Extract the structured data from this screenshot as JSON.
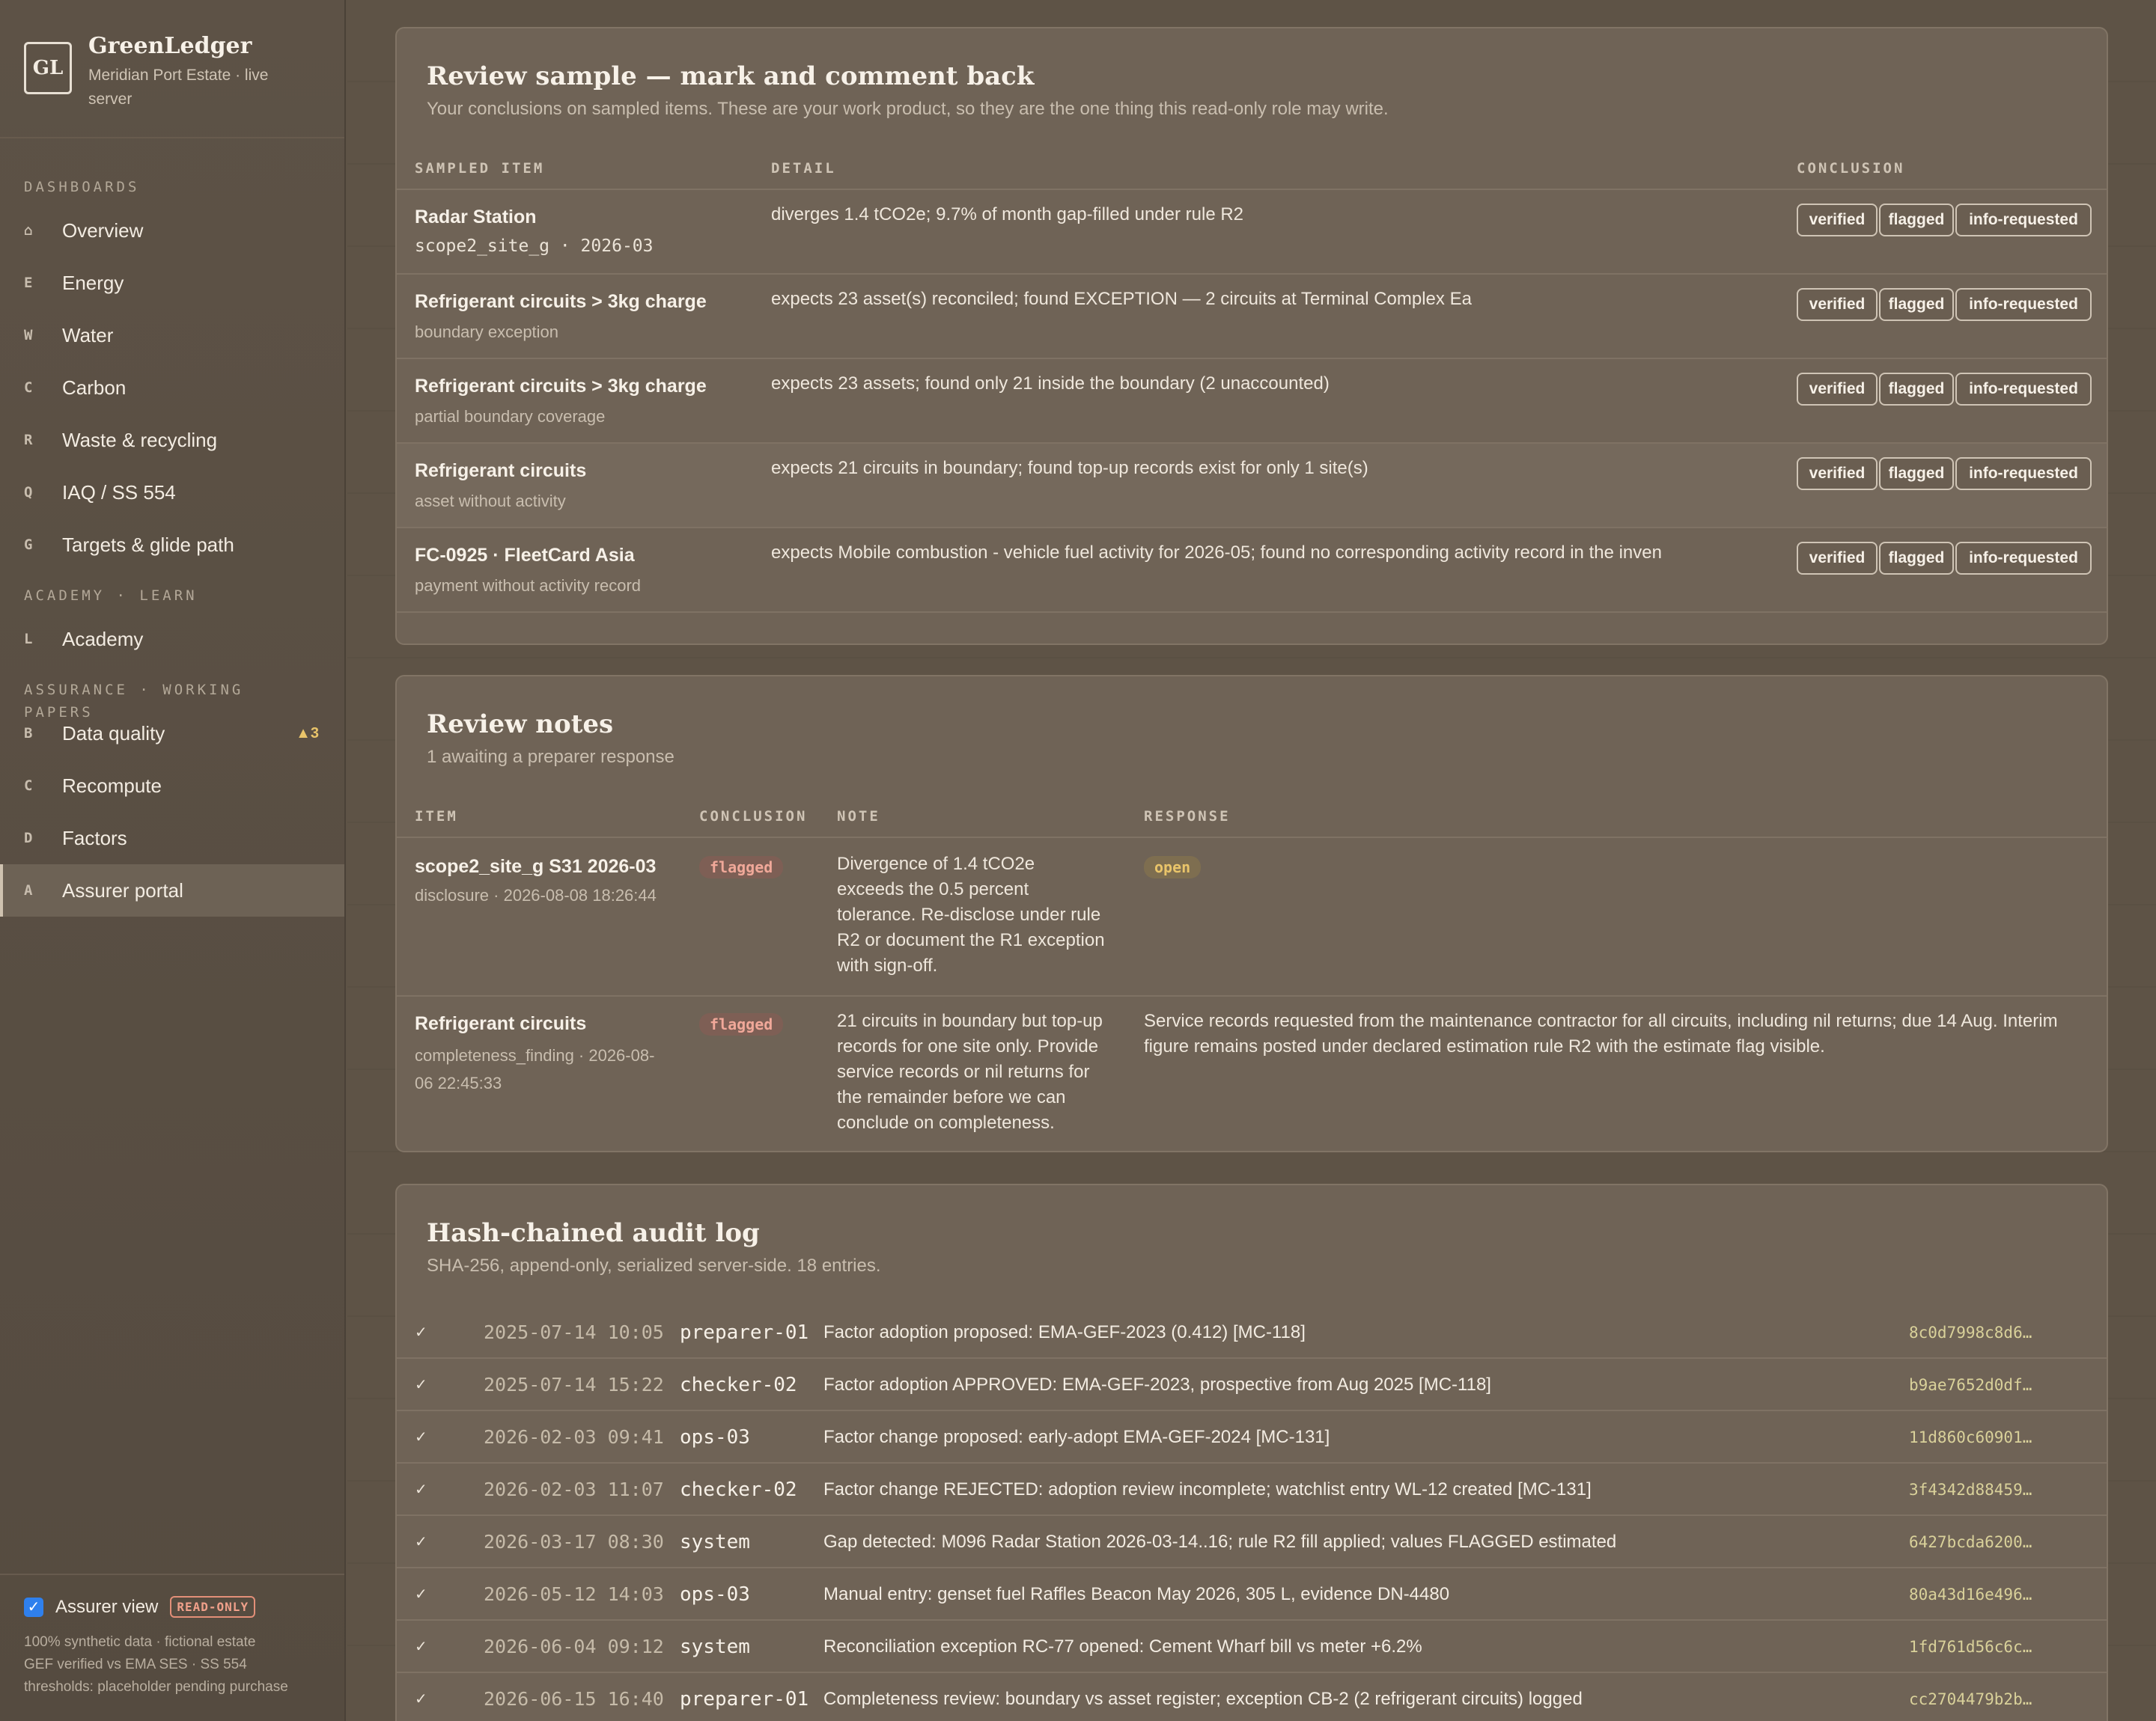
{
  "brand": {
    "logo": "GL",
    "name": "GreenLedger",
    "subtitle": "Meridian Port Estate · live server"
  },
  "sidebar": {
    "sections": [
      {
        "title": "DASHBOARDS",
        "items": [
          {
            "key": "⌂",
            "label": "Overview"
          },
          {
            "key": "E",
            "label": "Energy"
          },
          {
            "key": "W",
            "label": "Water"
          },
          {
            "key": "C",
            "label": "Carbon"
          },
          {
            "key": "R",
            "label": "Waste & recycling"
          },
          {
            "key": "Q",
            "label": "IAQ / SS 554"
          },
          {
            "key": "G",
            "label": "Targets & glide path"
          }
        ]
      },
      {
        "title": "ACADEMY · LEARN",
        "items": [
          {
            "key": "L",
            "label": "Academy"
          }
        ]
      },
      {
        "title": "ASSURANCE · WORKING PAPERS",
        "items": [
          {
            "key": "B",
            "label": "Data quality",
            "badge": "▲3"
          },
          {
            "key": "C",
            "label": "Recompute"
          },
          {
            "key": "D",
            "label": "Factors"
          },
          {
            "key": "A",
            "label": "Assurer portal",
            "active": true
          }
        ]
      }
    ],
    "footer": {
      "assurer_view_label": "Assurer view",
      "assurer_view_checked": true,
      "read_only_badge": "READ-ONLY",
      "lines": [
        "100% synthetic data · fictional estate",
        "GEF verified vs EMA SES · SS 554",
        "thresholds: placeholder pending purchase"
      ]
    }
  },
  "review_sample": {
    "title": "Review sample — mark and comment back",
    "subtitle": "Your conclusions on sampled items. These are your work product, so they are the one thing this read-only role may write.",
    "headers": {
      "item": "SAMPLED ITEM",
      "detail": "DETAIL",
      "conclusion": "CONCLUSION"
    },
    "buttons": [
      "verified",
      "flagged",
      "info-requested"
    ],
    "rows": [
      {
        "title": "Radar Station",
        "sub": "scope2_site_g · 2026-03",
        "sub_mono": true,
        "detail": "diverges 1.4 tCO2e; 9.7% of month gap-filled under rule R2"
      },
      {
        "title": "Refrigerant circuits > 3kg charge",
        "sub": "boundary exception",
        "detail": "expects 23 asset(s) reconciled; found EXCEPTION — 2 circuits at Terminal Complex Ea"
      },
      {
        "title": "Refrigerant circuits > 3kg charge",
        "sub": "partial boundary coverage",
        "detail": "expects 23 assets; found only 21 inside the boundary (2 unaccounted)"
      },
      {
        "title": "Refrigerant circuits",
        "sub": "asset without activity",
        "detail": "expects 21 circuits in boundary; found top-up records exist for only 1 site(s)"
      },
      {
        "title": "FC-0925 · FleetCard Asia",
        "sub": "payment without activity record",
        "detail": "expects Mobile combustion - vehicle fuel activity for 2026-05; found no corresponding activity record in the inven"
      }
    ]
  },
  "review_notes": {
    "title": "Review notes",
    "subtitle": "1 awaiting a preparer response",
    "headers": {
      "item": "ITEM",
      "conclusion": "CONCLUSION",
      "note": "NOTE",
      "response": "RESPONSE"
    },
    "rows": [
      {
        "title": "scope2_site_g S31 2026-03",
        "sub": "disclosure · 2026-08-08 18:26:44",
        "conclusion": "flagged",
        "note": "Divergence of 1.4 tCO2e exceeds the 0.5 percent tolerance. Re-disclose under rule R2 or document the R1 exception with sign-off.",
        "response": "open",
        "response_is_status": true
      },
      {
        "title": "Refrigerant circuits",
        "sub": "completeness_finding · 2026-08-06 22:45:33",
        "conclusion": "flagged",
        "note": "21 circuits in boundary but top-up records for one site only. Provide service records or nil returns for the remainder before we can conclude on completeness.",
        "response": "Service records requested from the maintenance contractor for all circuits, including nil returns; due 14 Aug. Interim figure remains posted under declared estimation rule R2 with the estimate flag visible.",
        "response_is_status": false
      }
    ]
  },
  "audit_log": {
    "title": "Hash-chained audit log",
    "subtitle": "SHA-256, append-only, serialized server-side. 18 entries.",
    "entries": [
      {
        "check": "✓",
        "time": "2025-07-14 10:05",
        "actor": "preparer-01",
        "message": "Factor adoption proposed: EMA-GEF-2023 (0.412) [MC-118]",
        "hash": "8c0d7998c8d6…"
      },
      {
        "check": "✓",
        "time": "2025-07-14 15:22",
        "actor": "checker-02",
        "message": "Factor adoption APPROVED: EMA-GEF-2023, prospective from Aug 2025 [MC-118]",
        "hash": "b9ae7652d0df…"
      },
      {
        "check": "✓",
        "time": "2026-02-03 09:41",
        "actor": "ops-03",
        "message": "Factor change proposed: early-adopt EMA-GEF-2024 [MC-131]",
        "hash": "11d860c60901…"
      },
      {
        "check": "✓",
        "time": "2026-02-03 11:07",
        "actor": "checker-02",
        "message": "Factor change REJECTED: adoption review incomplete; watchlist entry WL-12 created [MC-131]",
        "hash": "3f4342d88459…"
      },
      {
        "check": "✓",
        "time": "2026-03-17 08:30",
        "actor": "system",
        "message": "Gap detected: M096 Radar Station 2026-03-14..16; rule R2 fill applied; values FLAGGED estimated",
        "hash": "6427bcda6200…"
      },
      {
        "check": "✓",
        "time": "2026-05-12 14:03",
        "actor": "ops-03",
        "message": "Manual entry: genset fuel Raffles Beacon May 2026, 305 L, evidence DN-4480",
        "hash": "80a43d16e496…"
      },
      {
        "check": "✓",
        "time": "2026-06-04 09:12",
        "actor": "system",
        "message": "Reconciliation exception RC-77 opened: Cement Wharf bill vs meter +6.2%",
        "hash": "1fd761d56c6c…"
      },
      {
        "check": "✓",
        "time": "2026-06-15 16:40",
        "actor": "preparer-01",
        "message": "Completeness review: boundary vs asset register; exception CB-2 (2 refrigerant circuits) logged",
        "hash": "cc2704479b2b…"
      }
    ]
  }
}
